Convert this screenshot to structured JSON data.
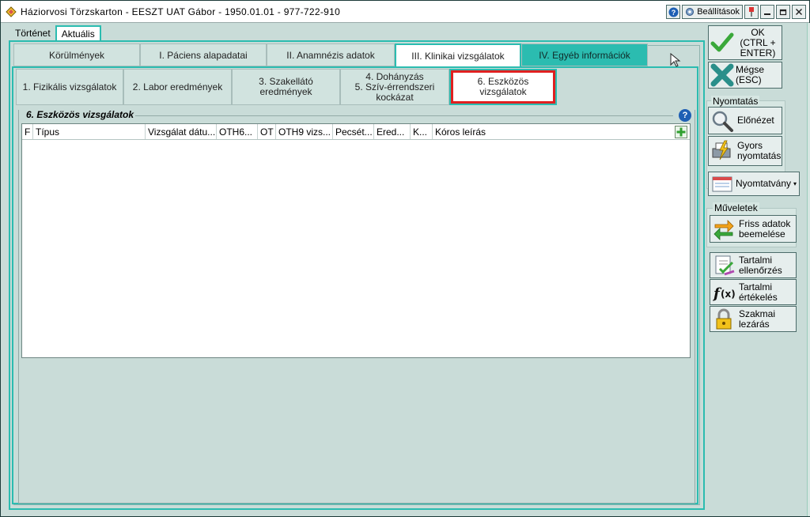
{
  "window": {
    "title": "Háziorvosi Törzskarton - EESZT UAT Gábor - 1950.01.01 - 977-722-910",
    "settings_label": "Beállítások"
  },
  "top_tabs": [
    {
      "label": "Történet"
    },
    {
      "label": "Aktuális"
    }
  ],
  "main_tabs": [
    {
      "label": "Körülmények"
    },
    {
      "label": "I. Páciens alapadatai"
    },
    {
      "label": "II. Anamnézis adatok"
    },
    {
      "label": "III. Klinikai vizsgálatok"
    },
    {
      "label": "IV. Egyéb információk"
    }
  ],
  "sub_tabs": [
    {
      "label": "1. Fizikális vizsgálatok"
    },
    {
      "label": "2. Labor eredmények"
    },
    {
      "label": "3. Szakellátó eredmények"
    },
    {
      "label_line1": "4. Dohányzás",
      "label_line2": "5. Szív-érrendszeri",
      "label_line3": "kockázat"
    },
    {
      "label": "6. Eszközös vizsgálatok"
    }
  ],
  "section": {
    "title": "6. Eszközös vizsgálatok"
  },
  "grid": {
    "columns": [
      "F",
      "Típus",
      "Vizsgálat dátu...",
      "OTH6...",
      "OT",
      "OTH9 vizs...",
      "Pecsét...",
      "Ered...",
      "K...",
      "Kóros leírás"
    ],
    "rows": []
  },
  "sidebar": {
    "ok_line1": "OK",
    "ok_line2": "(CTRL +",
    "ok_line3": "ENTER)",
    "cancel_line1": "Mégse",
    "cancel_line2": "(ESC)",
    "print_section": "Nyomtatás",
    "preview": "Előnézet",
    "quick_print_line1": "Gyors",
    "quick_print_line2": "nyomtatás",
    "form_print": "Nyomtatvány",
    "ops_section": "Műveletek",
    "fresh_line1": "Friss adatok",
    "fresh_line2": "beemelése",
    "content_check_line1": "Tartalmi",
    "content_check_line2": "ellenőrzés",
    "content_eval_line1": "Tartalmi",
    "content_eval_line2": "értékelés",
    "close_line1": "Szakmai",
    "close_line2": "lezárás"
  },
  "colors": {
    "accent_teal": "#2bbcb0",
    "background": "#c9dcd8",
    "highlight_red": "#e02020"
  }
}
